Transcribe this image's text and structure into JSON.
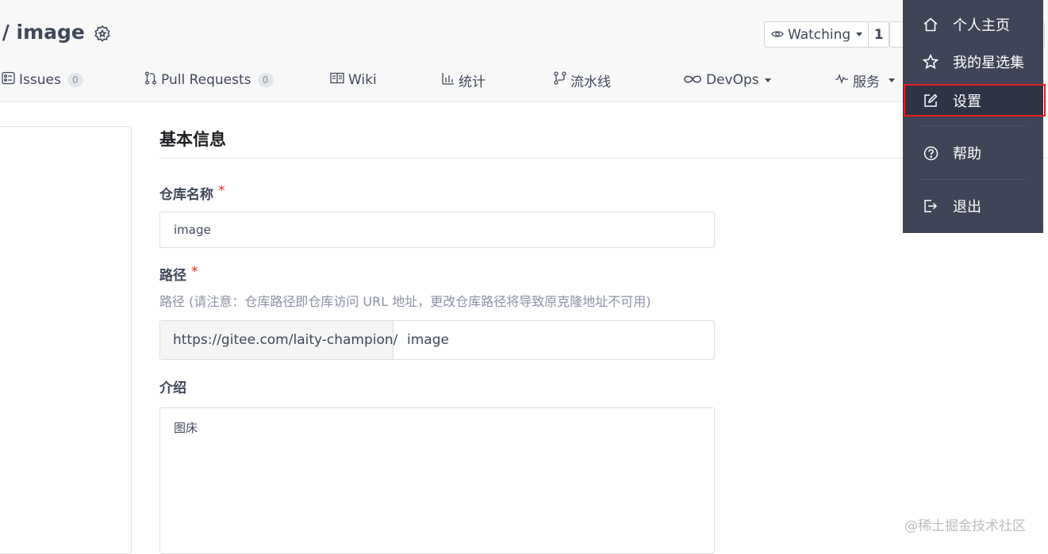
{
  "header": {
    "repo_title": " / image",
    "watch_label": "Watching",
    "watch_count": "1"
  },
  "tabs": [
    {
      "label": "Issues",
      "count": "0",
      "icon": "issues-icon"
    },
    {
      "label": "Pull Requests",
      "count": "0",
      "icon": "pull-request-icon"
    },
    {
      "label": "Wiki",
      "icon": "wiki-icon"
    },
    {
      "label": "统计",
      "icon": "stats-icon"
    },
    {
      "label": "流水线",
      "icon": "pipeline-icon"
    },
    {
      "label": "DevOps",
      "icon": "infinity-icon"
    },
    {
      "label": "服务",
      "icon": "pulse-icon"
    }
  ],
  "form": {
    "section_title": "基本信息",
    "name_label": "仓库名称",
    "required_mark": "*",
    "name_value": "image",
    "path_label": "路径",
    "path_hint": "路径 (请注意：仓库路径即仓库访问 URL 地址，更改仓库路径将导致原克隆地址不可用)",
    "path_prefix": "https://gitee.com/laity-champion/",
    "path_value": "image",
    "intro_label": "介绍",
    "intro_value": "图床"
  },
  "dropdown": {
    "items": [
      {
        "label": "个人主页",
        "icon": "home-icon"
      },
      {
        "label": "我的星选集",
        "icon": "star-icon"
      },
      {
        "label": "设置",
        "icon": "edit-icon"
      },
      {
        "label": "帮助",
        "icon": "help-icon"
      },
      {
        "label": "退出",
        "icon": "logout-icon"
      }
    ]
  },
  "watermark": "@稀土掘金技术社区",
  "colors": {
    "dropdown_bg": "#3f4456",
    "highlight": "#e02020",
    "required": "#db2828"
  }
}
